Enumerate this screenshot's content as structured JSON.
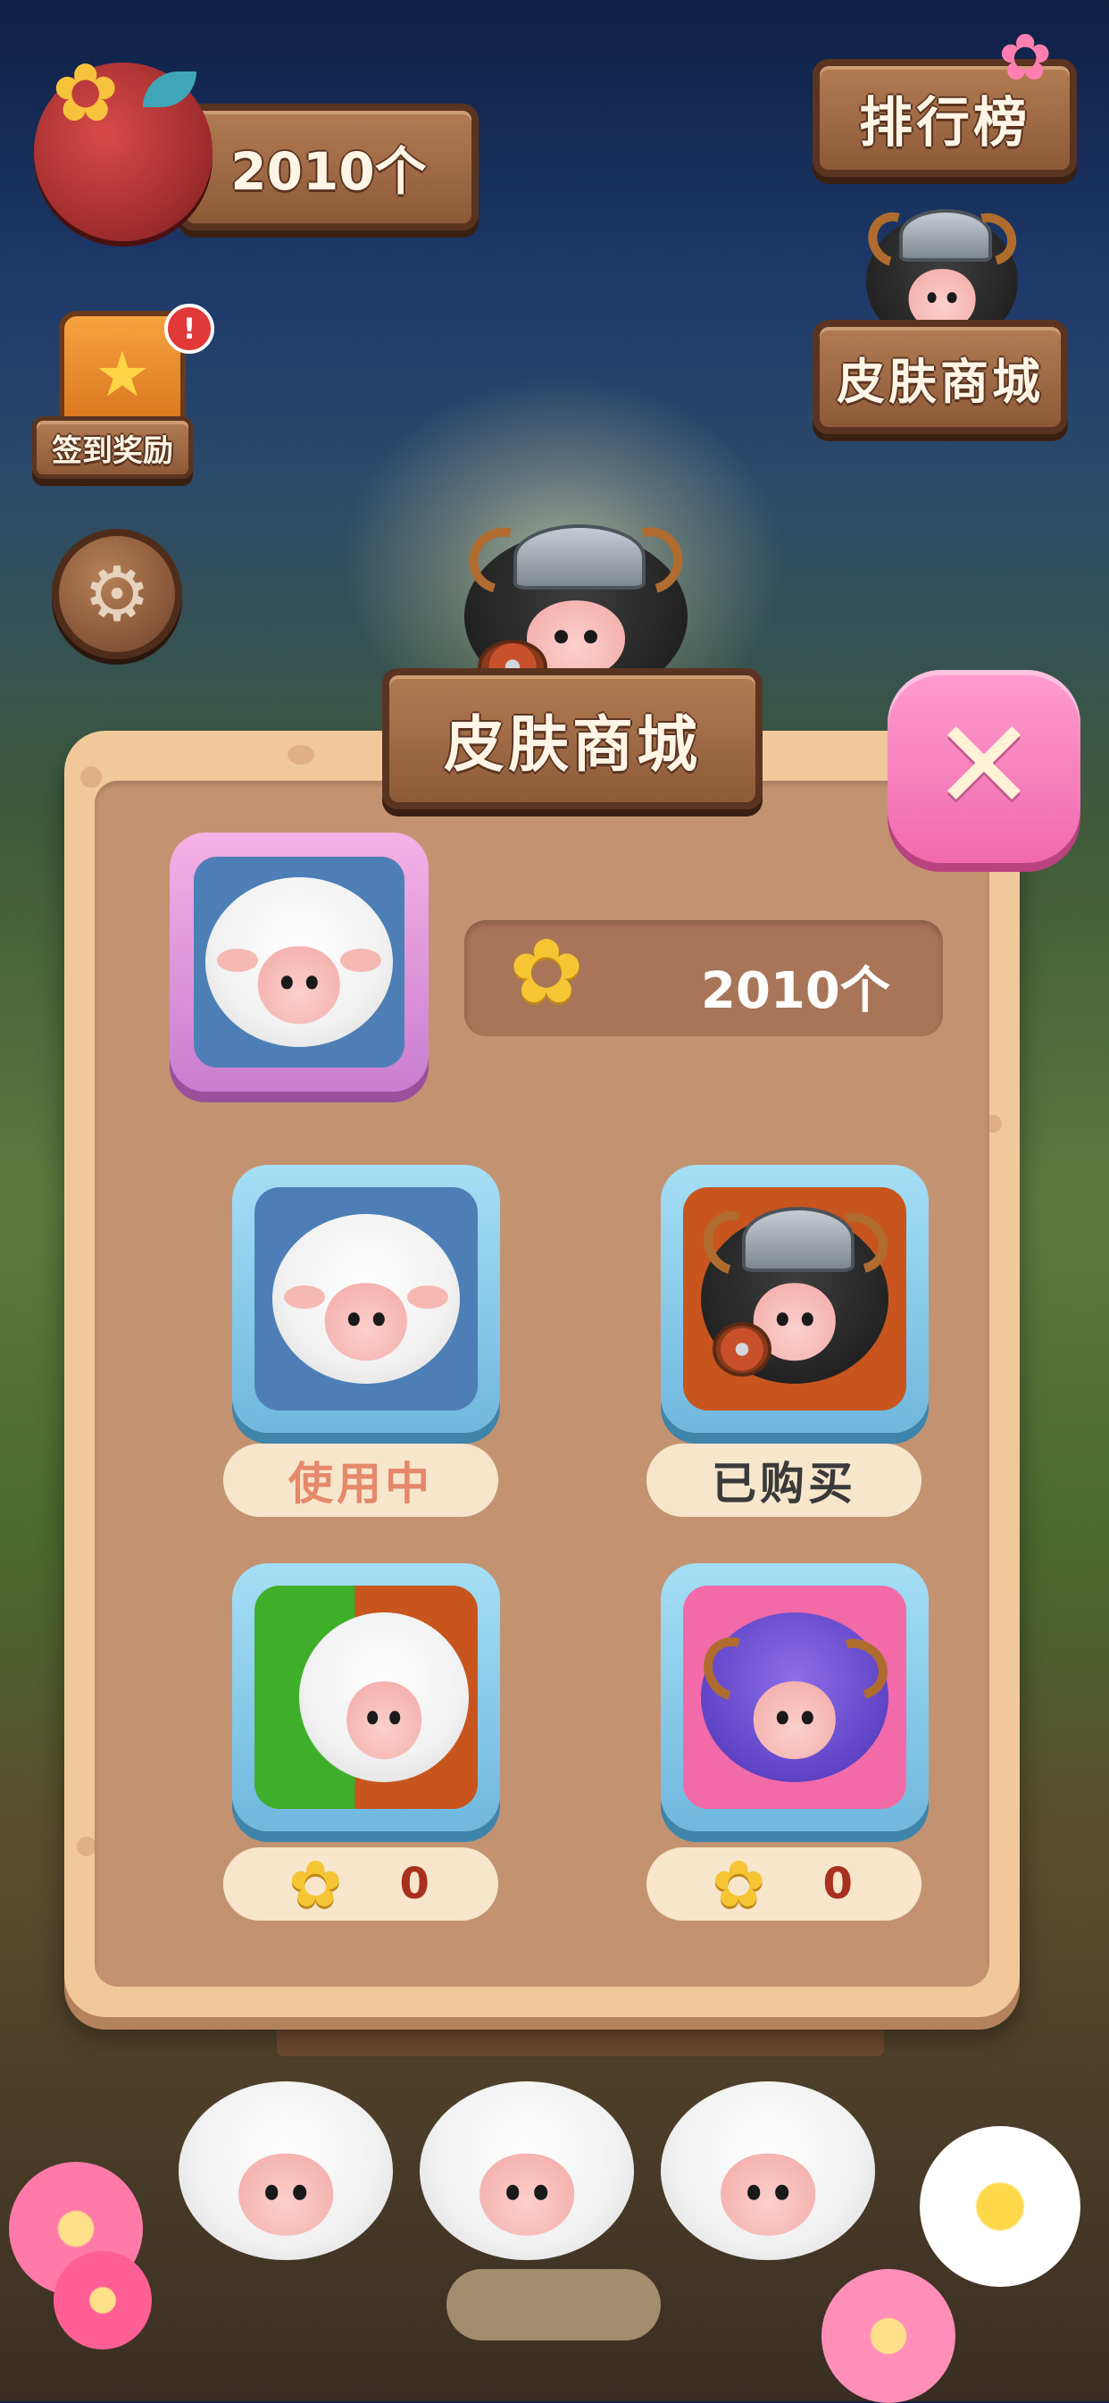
{
  "hud": {
    "currency_amount": "2010个",
    "leaderboard_label": "排行榜",
    "skin_shop_label": "皮肤商城",
    "checkin_label": "签到奖励",
    "checkin_badge": "!",
    "settings_icon": "gear-icon"
  },
  "modal": {
    "title": "皮肤商城",
    "close_icon": "✕",
    "balance": "2010个",
    "skins": [
      {
        "name": "classic-sheep",
        "status": "使用中"
      },
      {
        "name": "viking-sheep",
        "status": "已购买"
      },
      {
        "name": "turtle-sheep",
        "price": "0"
      },
      {
        "name": "ram-sheep",
        "price": "0"
      }
    ]
  },
  "colors": {
    "accent_pink": "#f06aaf",
    "wood": "#8d5a39",
    "panel": "#f0c89a",
    "card_blue": "#6fb7de",
    "flower": "#f5c533"
  }
}
